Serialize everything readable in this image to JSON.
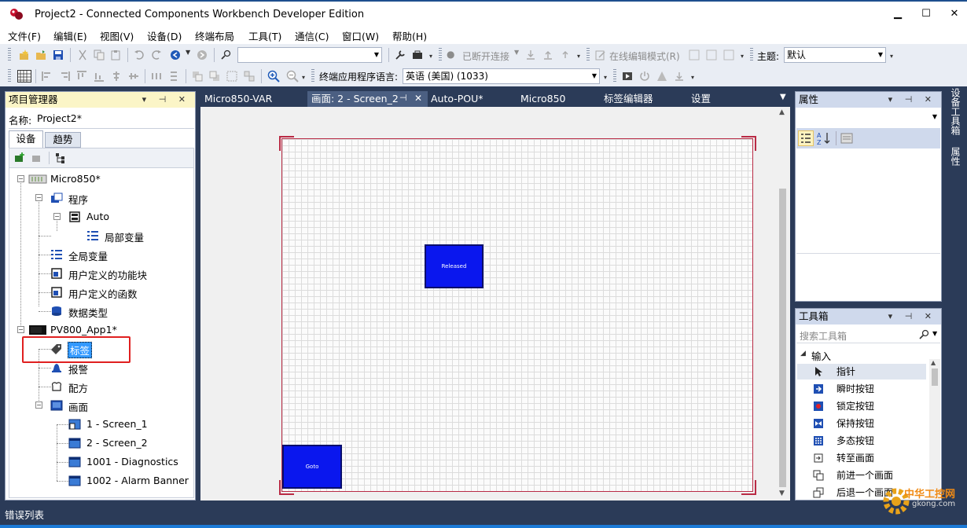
{
  "window": {
    "title": "Project2 - Connected Components Workbench Developer Edition",
    "minimize": "▁",
    "maximize": "☐",
    "close": "✕"
  },
  "menu": [
    "文件(F)",
    "编辑(E)",
    "视图(V)",
    "设备(D)",
    "终端布局",
    "工具(T)",
    "通信(C)",
    "窗口(W)",
    "帮助(H)"
  ],
  "toolbar1": {
    "disconnected": "已断开连接",
    "online_edit": "在线编辑模式(R)",
    "theme_label": "主题:",
    "theme_value": "默认",
    "search_value": ""
  },
  "toolbar2": {
    "lang_label": "终端应用程序语言:",
    "lang_value": "英语 (美国) (1033)"
  },
  "project_manager": {
    "title": "项目管理器",
    "name_label": "名称:",
    "name_value": "Project2*",
    "tabs": [
      "设备",
      "趋势"
    ],
    "tree": [
      {
        "label": "Micro850*"
      },
      {
        "label": "程序"
      },
      {
        "label": "Auto"
      },
      {
        "label": "局部变量"
      },
      {
        "label": "全局变量"
      },
      {
        "label": "用户定义的功能块"
      },
      {
        "label": "用户定义的函数"
      },
      {
        "label": "数据类型"
      },
      {
        "label": "PV800_App1*"
      },
      {
        "label": "标签"
      },
      {
        "label": "报警"
      },
      {
        "label": "配方"
      },
      {
        "label": "画面"
      },
      {
        "label": "1 - Screen_1"
      },
      {
        "label": "2 - Screen_2"
      },
      {
        "label": "1001 - Diagnostics"
      },
      {
        "label": "1002 - Alarm Banner"
      }
    ]
  },
  "doc_tabs": [
    "Micro850-VAR",
    "画面: 2 - Screen_2",
    "Auto-POU*",
    "Micro850",
    "标签编辑器",
    "设置"
  ],
  "doc_tab_pin": "⊣",
  "doc_tab_close": "✕",
  "canvas": {
    "buttons": [
      {
        "label": "Released"
      },
      {
        "label": "Goto"
      }
    ]
  },
  "properties": {
    "title": "属性"
  },
  "toolbox": {
    "title": "工具箱",
    "search_placeholder": "搜索工具箱",
    "group": "输入",
    "items": [
      "指针",
      "瞬时按钮",
      "锁定按钮",
      "保持按钮",
      "多态按钮",
      "转至画面",
      "前进一个画面",
      "后退一个画面"
    ]
  },
  "right_strip": [
    "设备工具箱",
    "属性"
  ],
  "status": {
    "error_list": "错误列表"
  },
  "watermark": {
    "text": "中华工控网",
    "url": "gkong.com"
  }
}
